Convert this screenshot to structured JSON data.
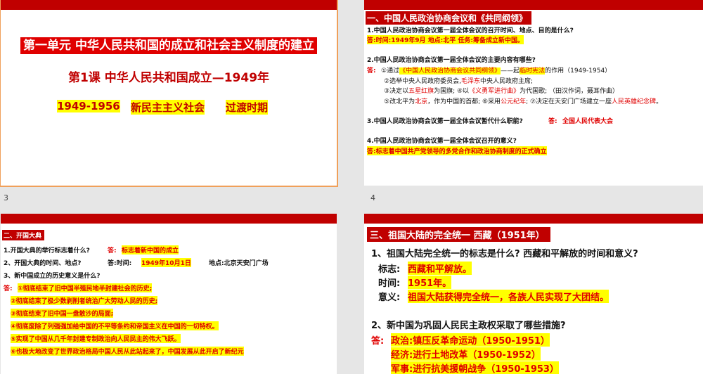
{
  "slide_numbers": [
    "3",
    "4"
  ],
  "s1": {
    "title": "第一单元  中华人民共和国的成立和社会主义制度的建立",
    "lesson": "第1课  中华人民共和国成立—1949年",
    "years": "1949-1956",
    "society": "新民主主义社会",
    "period": "过渡时期"
  },
  "s2": {
    "heading": "一、中国人民政治协商会议和《共同纲领》",
    "q1": "1.中国人民政治协商会议第一届全体会议的召开时间、地点、目的是什么?",
    "a1": "答:时间:1949年9月  地点:北平  任务:筹备成立新中国。",
    "q2": "2.中国人民政治协商会议第一届全体会议的主要内容有哪些?",
    "a2_label": "答:",
    "a2_1a": "①通过",
    "a2_1b": "《中国人民政治协商会议共同纲领》",
    "a2_1c": "——起",
    "a2_1d": "临时宪法",
    "a2_1e": "的作用（1949-1954）",
    "a2_2a": "②选举中央人民政府委员会,",
    "a2_2b": "毛泽东",
    "a2_2c": "中央人民政府主席;",
    "a2_3a": "③决定以",
    "a2_3b": "五星红旗",
    "a2_3c": "为国旗;        ④以",
    "a2_3d": "《义勇军进行曲》",
    "a2_3e": "为代国歌;   （田汉作词，聂耳作曲）",
    "a2_4a": "⑤改北平为",
    "a2_4b": "北京",
    "a2_4c": "，作为中国的首都;    ⑥采用",
    "a2_4d": "公元纪年",
    "a2_4e": ";    ⑦决定在天安门广场建立一座",
    "a2_4f": "人民英雄纪念碑",
    "a2_4g": "。",
    "q3": "3.中国人民政治协商会议第一届全体会议暂代什么职能?",
    "a3_label": "答:",
    "a3": "全国人民代表大会",
    "q4": "4.中国人民政治协商会议第一届全体会议召开的意义?",
    "a4": "答:标志着中国共产党领导的多党合作和政治协商制度的正式确立"
  },
  "s3": {
    "heading": "二、开国大典",
    "q1": "1.开国大典的举行标志着什么?",
    "a1_label": "答:",
    "a1": "标志着新中国的成立",
    "q2": "2、开国大典的时间、地点?",
    "a2_label": "答:时间:",
    "a2_time": "1949年10月1日",
    "a2_place": "地点:北京天安门广场",
    "q3": "3、新中国成立的历史意义是什么?",
    "a3_label": "答:",
    "items": [
      "①彻底结束了旧中国半殖民地半封建社会的历史;",
      "②彻底结束了极少数剥削者统治广大劳动人民的历史;",
      "③彻底结束了旧中国一盘散沙的局面;",
      "④彻底废除了列强强加给中国的不平等条约和帝国主义在中国的一切特权。",
      "⑤实现了中国从几千年封建专制政治向人民民主的伟大飞跃。",
      "⑥也极大地改变了世界政治格局中国人民从此站起来了，中国发展从此开启了新纪元"
    ]
  },
  "s4": {
    "heading": "三、祖国大陆的完全统一  西藏（1951年）",
    "q1": "1、祖国大陆完全统一的标志是什么? 西藏和平解放的时间和意义?",
    "r1_label": "标志:",
    "r1": "西藏和平解放。",
    "r2_label": "时间:",
    "r2": "1951年。",
    "r3_label": "意义:",
    "r3": "祖国大陆获得完全统一，各族人民实现了大团结。",
    "q2": "2、新中国为巩固人民民主政权采取了哪些措施?",
    "a_label": "答:",
    "m1": "政治:镇压反革命运动（1950-1951）",
    "m2": "经济:进行土地改革（1950-1952）",
    "m3": "军事:进行抗美援朝战争（1950-1953）"
  }
}
